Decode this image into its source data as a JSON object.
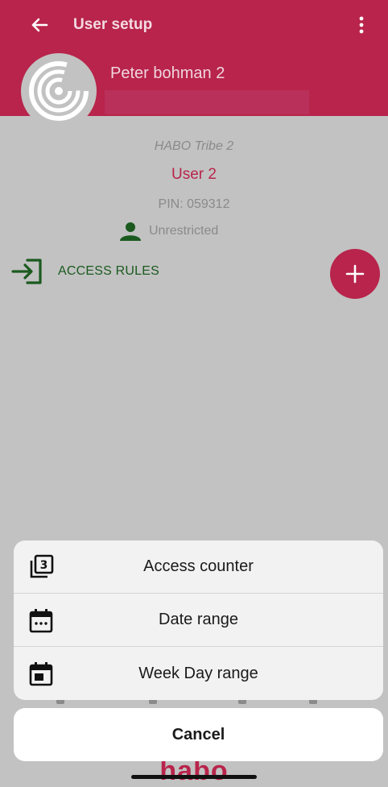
{
  "header": {
    "title": "User setup",
    "back_icon": "arrow-left-icon",
    "menu_icon": "more-vertical-icon",
    "user_name": "Peter bohman 2",
    "avatar_icon": "fingerprint-lock-icon"
  },
  "details": {
    "lock_name": "HABO Tribe 2",
    "user_label": "User 2",
    "pin": "PIN: 059312",
    "restriction_icon": "person-icon",
    "restriction": "Unrestricted"
  },
  "access_rules": {
    "icon": "login-icon",
    "label": "ACCESS RULES",
    "add_icon": "plus-icon"
  },
  "action_sheet": {
    "items": [
      {
        "label": "Access counter",
        "icon": "counter-3-icon"
      },
      {
        "label": "Date range",
        "icon": "calendar-dots-icon"
      },
      {
        "label": "Week Day range",
        "icon": "calendar-block-icon"
      }
    ],
    "cancel_label": "Cancel"
  },
  "footer": {
    "brand": "habo"
  },
  "colors": {
    "brand": "#b8244b",
    "overlay": "#c2c2c2",
    "green": "#1b5a1f",
    "sheet": "#f2f2f2"
  }
}
